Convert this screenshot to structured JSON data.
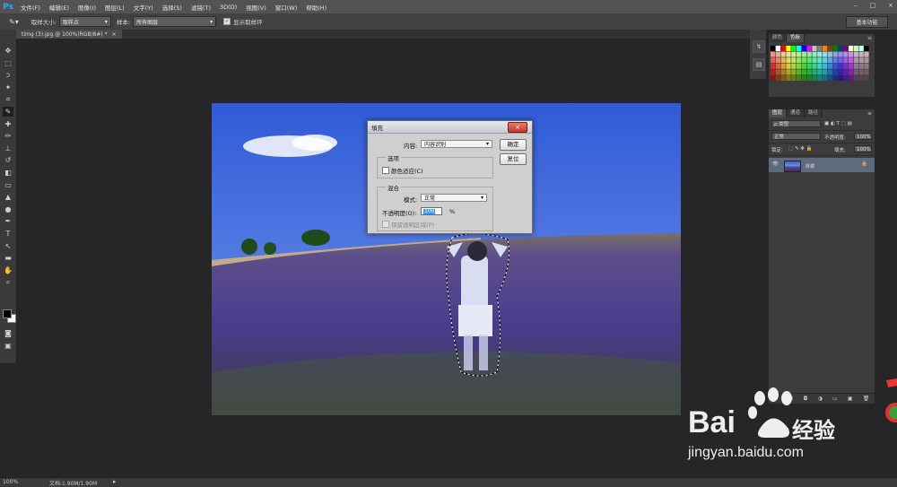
{
  "app": {
    "logo": "Ps"
  },
  "menu": {
    "items": [
      "文件(F)",
      "编辑(E)",
      "图像(I)",
      "图层(L)",
      "文字(Y)",
      "选择(S)",
      "滤镜(T)",
      "3D(D)",
      "视图(V)",
      "窗口(W)",
      "帮助(H)"
    ]
  },
  "window_controls": {
    "minimize": "–",
    "maximize": "□",
    "close": "×"
  },
  "options_bar": {
    "tool_icon": "eyedropper-icon",
    "sample_size_label": "取样大小:",
    "sample_size_value": "取样点",
    "sample_label": "样本:",
    "sample_value": "所有图层",
    "show_ring_label": "显示取样环",
    "workspace": "基本功能"
  },
  "document_tab": {
    "title": "timg (3).jpg @ 100%(RGB/8#) *",
    "close": "×"
  },
  "tools": [
    "move-icon",
    "marquee-icon",
    "lasso-icon",
    "quick-select-icon",
    "crop-icon",
    "eyedropper-icon",
    "healing-icon",
    "brush-icon",
    "stamp-icon",
    "history-brush-icon",
    "eraser-icon",
    "gradient-icon",
    "blur-icon",
    "dodge-icon",
    "pen-icon",
    "type-icon",
    "path-select-icon",
    "shape-icon",
    "hand-icon",
    "zoom-icon"
  ],
  "tool_glyphs": [
    "✥",
    "⬚",
    "ↄ",
    "✦",
    "⌗",
    "✎",
    "✚",
    "✏",
    "⊥",
    "↺",
    "◧",
    "▭",
    "▲",
    "●",
    "✒",
    "T",
    "↖",
    "▬",
    "✋",
    "⌕"
  ],
  "fill_dialog": {
    "title": "填充",
    "close": "×",
    "content_label": "内容:",
    "content_value": "内容识别",
    "ok": "确定",
    "reset": "复位",
    "options_label": "选项",
    "color_adapt_label": "颜色适应(C)",
    "blend_label": "混合",
    "mode_label": "模式:",
    "mode_value": "正常",
    "opacity_label": "不透明度(O):",
    "opacity_value": "100",
    "opacity_unit": "%",
    "preserve_label": "保留透明区域(P)"
  },
  "swatches_panel": {
    "tabs": [
      "颜色",
      "色板"
    ],
    "active_tab": 1
  },
  "layers_panel": {
    "tabs": [
      "图层",
      "通道",
      "路径"
    ],
    "active_tab": 0,
    "filter_label": "ρ 类型",
    "blend_mode": "正常",
    "opacity_label": "不透明度:",
    "opacity_value": "100%",
    "lock_label": "锁定:",
    "fill_label": "填充:",
    "fill_value": "100%",
    "layer_name": "背景",
    "bottom_icons": [
      "∞",
      "fx",
      "◘",
      "◑",
      "▭",
      "▣",
      "🗑"
    ]
  },
  "status_bar": {
    "zoom": "100%",
    "doc_info": "文档:1.90M/1.90M",
    "arrow": "▸"
  },
  "watermark": {
    "brand": "Bai",
    "brand_suffix": "经验",
    "url": "jingyan.baidu.com"
  },
  "colors": {
    "accent": "#31a8ff",
    "layer_selected": "#5f6a7f",
    "dialog_bg": "#cfcfcf"
  }
}
